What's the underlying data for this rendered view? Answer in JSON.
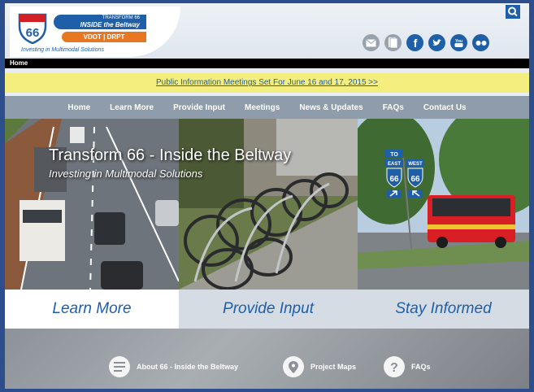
{
  "logo": {
    "route_number": "66",
    "badge_top": "TRANSFORM 66",
    "badge_bottom": "INSIDE the Beltway",
    "partners": "VDOT | DRPT",
    "tagline": "Investing in Multimodal Solutions"
  },
  "breadcrumb": "Home",
  "banner": {
    "text": "Public Information Meetings Set For June 16 and 17, 2015 >>"
  },
  "nav": [
    "Home",
    "Learn More",
    "Provide Input",
    "Meetings",
    "News & Updates",
    "FAQs",
    "Contact Us"
  ],
  "hero": {
    "title": "Transform 66 - Inside the Beltway",
    "subtitle": "Investing in Multimodal Solutions",
    "sign_to": "TO",
    "sign_east": "EAST",
    "sign_west": "WEST",
    "sign_num": "66"
  },
  "tabs": [
    "Learn More",
    "Provide Input",
    "Stay Informed"
  ],
  "quick_links": [
    "About 66 - Inside the Beltway",
    "Project Maps",
    "FAQs"
  ],
  "colors": {
    "brand": "#1f5fa8",
    "accent": "#e87722",
    "banner": "#f4ee7e"
  },
  "icons": {
    "search": "search-icon",
    "social": [
      "email-icon",
      "document-icon",
      "facebook-icon",
      "twitter-icon",
      "youtube-icon",
      "flickr-icon"
    ],
    "quick_links": [
      "document-lines-icon",
      "map-pin-icon",
      "question-icon"
    ]
  }
}
